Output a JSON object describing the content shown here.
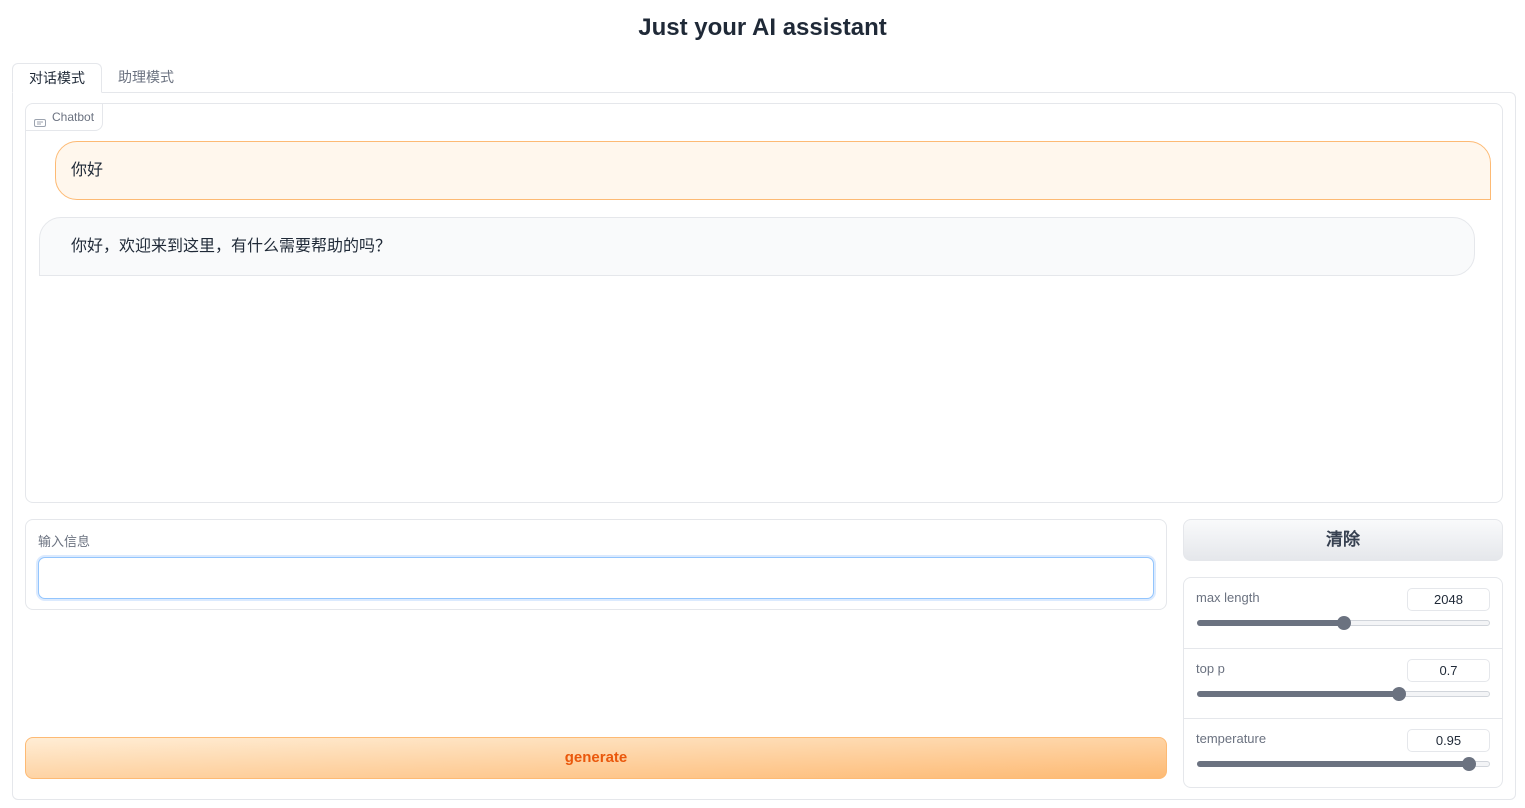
{
  "app": {
    "title": "Just your AI assistant"
  },
  "tabs": [
    {
      "label": "对话模式",
      "active": true
    },
    {
      "label": "助理模式",
      "active": false
    }
  ],
  "chatbot": {
    "label": "Chatbot",
    "messages": [
      {
        "role": "user",
        "text": "你好"
      },
      {
        "role": "bot",
        "text": "你好，欢迎来到这里，有什么需要帮助的吗？"
      }
    ]
  },
  "input": {
    "label": "输入信息",
    "value": "",
    "placeholder": ""
  },
  "buttons": {
    "generate": "generate",
    "clear": "清除"
  },
  "sliders": [
    {
      "label": "max length",
      "value": "2048",
      "fraction": 0.5
    },
    {
      "label": "top p",
      "value": "0.7",
      "fraction": 0.69
    },
    {
      "label": "temperature",
      "value": "0.95",
      "fraction": 0.93
    }
  ],
  "colors": {
    "accent": "#fdba74",
    "generate_text": "#ea580c",
    "user_bubble": "#fff7ed"
  }
}
